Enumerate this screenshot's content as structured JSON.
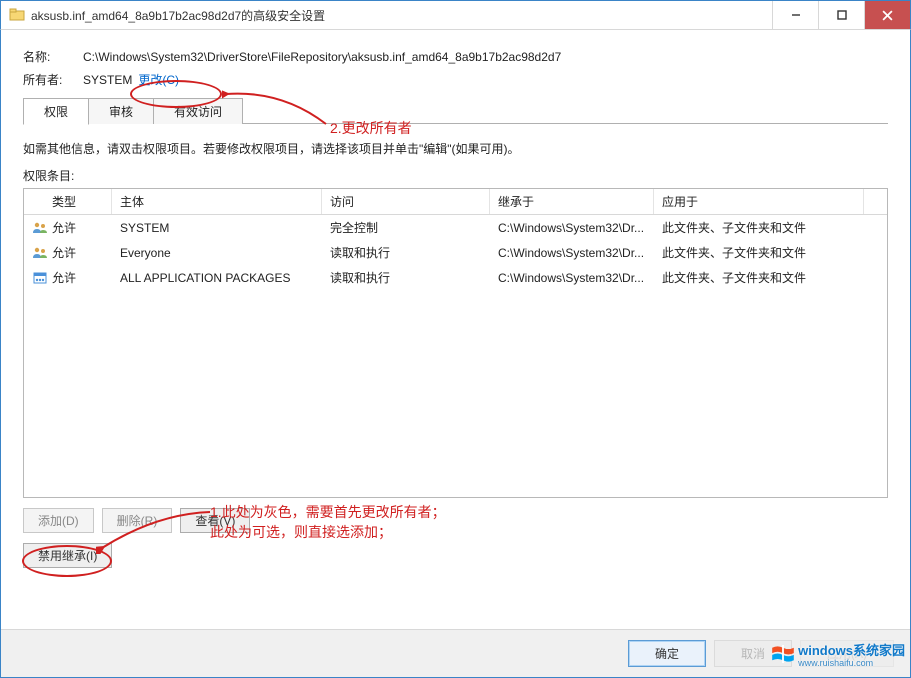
{
  "window": {
    "title": "aksusb.inf_amd64_8a9b17b2ac98d2d7的高级安全设置"
  },
  "header": {
    "name_label": "名称:",
    "name_value": "C:\\Windows\\System32\\DriverStore\\FileRepository\\aksusb.inf_amd64_8a9b17b2ac98d2d7",
    "owner_label": "所有者:",
    "owner_value": "SYSTEM",
    "change_link": "更改(C)"
  },
  "tabs": {
    "perm": "权限",
    "audit": "审核",
    "effective": "有效访问"
  },
  "body": {
    "hint": "如需其他信息，请双击权限项目。若要修改权限项目，请选择该项目并单击\"编辑\"(如果可用)。",
    "entries_label": "权限条目:"
  },
  "columns": {
    "type": "类型",
    "principal": "主体",
    "access": "访问",
    "inherited": "继承于",
    "applies": "应用于"
  },
  "rows": [
    {
      "icon": "users",
      "type": "允许",
      "principal": "SYSTEM",
      "access": "完全控制",
      "inherited": "C:\\Windows\\System32\\Dr...",
      "applies": "此文件夹、子文件夹和文件"
    },
    {
      "icon": "users",
      "type": "允许",
      "principal": "Everyone",
      "access": "读取和执行",
      "inherited": "C:\\Windows\\System32\\Dr...",
      "applies": "此文件夹、子文件夹和文件"
    },
    {
      "icon": "pkg",
      "type": "允许",
      "principal": "ALL APPLICATION PACKAGES",
      "access": "读取和执行",
      "inherited": "C:\\Windows\\System32\\Dr...",
      "applies": "此文件夹、子文件夹和文件"
    }
  ],
  "buttons": {
    "add": "添加(D)",
    "remove": "删除(R)",
    "view": "查看(V)",
    "disable_inherit": "禁用继承(I)",
    "ok": "确定",
    "cancel": "取消",
    "apply": "应用(A)"
  },
  "annotations": {
    "note1a": "1.此处为灰色，需要首先更改所有者；",
    "note1b": "此处为可选，则直接选添加；",
    "note2": "2.更改所有者"
  },
  "watermark": {
    "brand": "windows系统家园",
    "url": "www.ruishaifu.com"
  }
}
